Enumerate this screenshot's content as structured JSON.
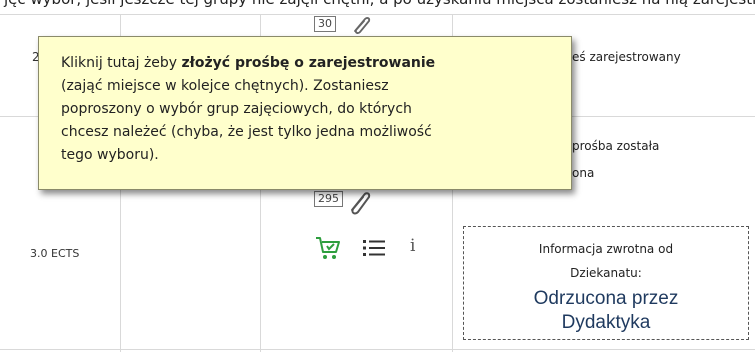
{
  "top_clipped_text": "jęć wybór, jeśli jeszcze tej grupy nie zajęli chętni, a po uzyskaniu miejsca zostaniesz na nią zarejestrowany.",
  "header_row": {
    "col1_partial": "2",
    "box_count": "30",
    "status_header_partial": "eś zarejestrowany"
  },
  "row": {
    "ects": "3.0 ECTS",
    "box_count": "295",
    "status_line1": "prośba została",
    "status_line2": "ona",
    "feedback_label_line1": "Informacja zwrotna od",
    "feedback_label_line2": "Dziekanatu:",
    "feedback_value_line1": "Odrzucona przez",
    "feedback_value_line2": "Dydaktyka"
  },
  "icons": {
    "attachment": "paperclip-icon",
    "cart": "cart-icon",
    "list": "list-icon",
    "info": "info-icon",
    "info_glyph": "i"
  },
  "tooltip": {
    "line1_plain": "Kliknij tutaj żeby ",
    "line1_bold": "złożyć prośbę o zarejestrowanie",
    "line2": "(zająć miejsce w kolejce chętnych). Zostaniesz",
    "line3": "poproszony o wybór grup zajęciowych, do których",
    "line4": "chcesz należeć (chyba, że jest tylko jedna możliwość",
    "line5": "tego wyboru)."
  },
  "colors": {
    "tooltip_bg": "#ffffcc",
    "cart_green": "#2e9e3e",
    "feedback_value": "#1f3a5f",
    "grid": "#d9d9d9"
  }
}
